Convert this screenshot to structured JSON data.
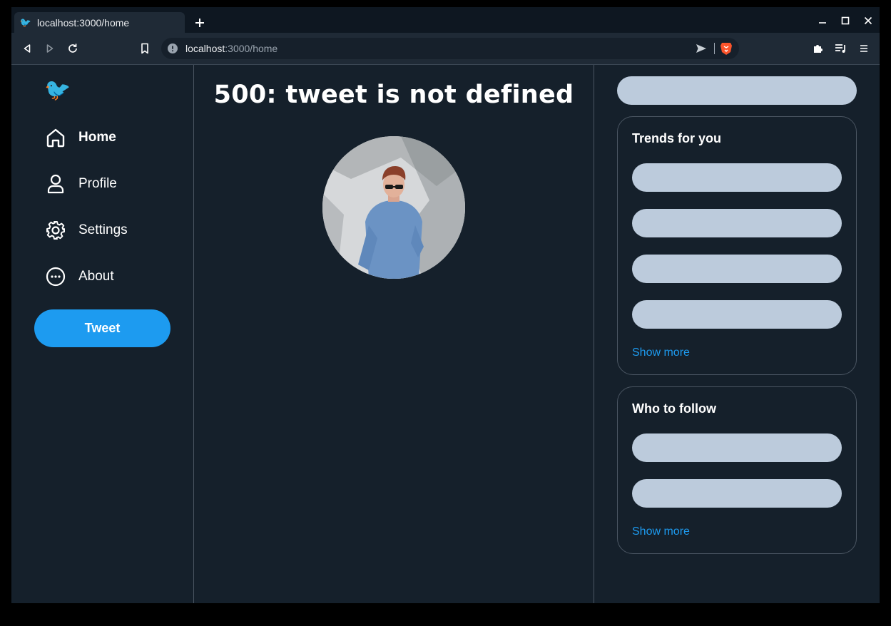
{
  "browser": {
    "tab_title": "localhost:3000/home",
    "url_host": "localhost",
    "url_path": ":3000/home",
    "tab_favicon": "twitter-bird-icon"
  },
  "sidebar": {
    "logo_icon": "twitter-bird-icon",
    "items": [
      {
        "label": "Home",
        "icon": "home-icon"
      },
      {
        "label": "Profile",
        "icon": "user-icon"
      },
      {
        "label": "Settings",
        "icon": "gear-icon"
      },
      {
        "label": "About",
        "icon": "more-circle-icon"
      }
    ],
    "tweet_label": "Tweet"
  },
  "main": {
    "error_title": "500: tweet is not defined"
  },
  "right": {
    "trends": {
      "title": "Trends for you",
      "show_more": "Show more"
    },
    "follow": {
      "title": "Who to follow",
      "show_more": "Show more"
    }
  },
  "colors": {
    "background": "#15202b",
    "accent": "#1d9bf0",
    "skeleton": "#bccbdc",
    "border": "#4a5562"
  }
}
